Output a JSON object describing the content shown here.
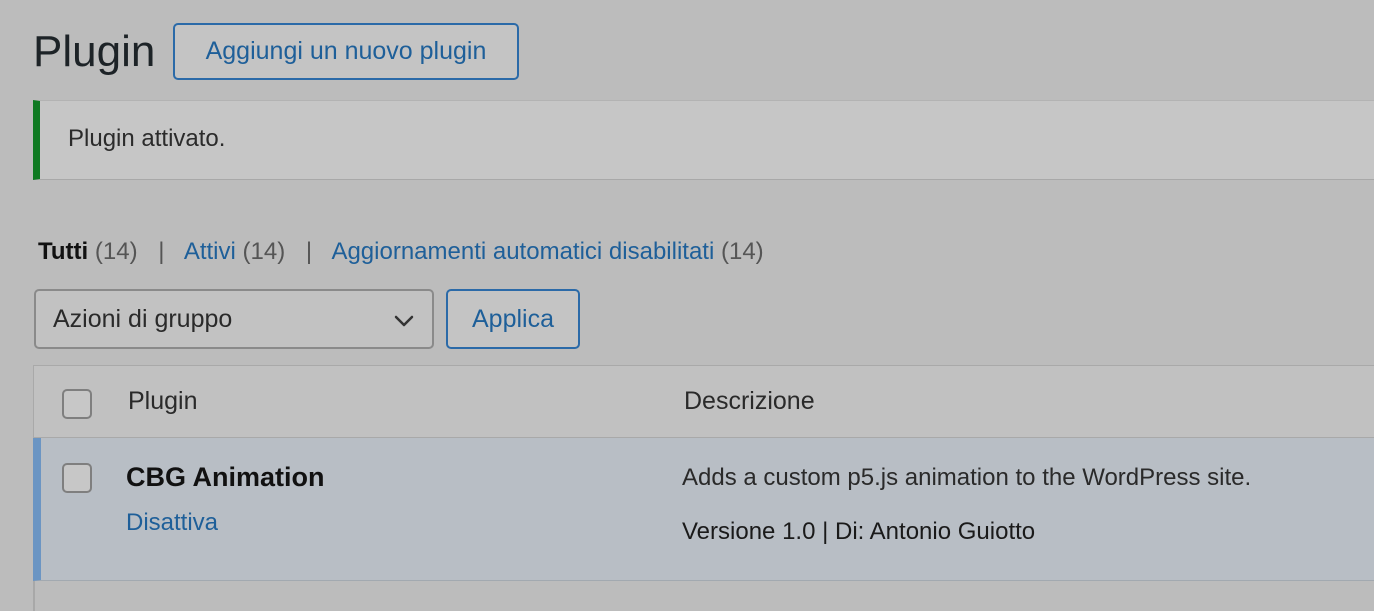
{
  "header": {
    "title": "Plugin",
    "add_new_label": "Aggiungi un nuovo plugin"
  },
  "notice": {
    "message": "Plugin attivato.",
    "accent_color": "#0f7a22"
  },
  "filters": {
    "all_label": "Tutti",
    "all_count": "(14)",
    "active_label": "Attivi",
    "active_count": "(14)",
    "auto_updates_label": "Aggiornamenti automatici disabilitati",
    "auto_updates_count": "(14)",
    "separator": "|"
  },
  "bulk_actions": {
    "selected": "Azioni di gruppo",
    "apply_label": "Applica"
  },
  "table": {
    "columns": [
      "Plugin",
      "Descrizione"
    ],
    "rows": [
      {
        "name": "CBG Animation",
        "action": "Disattiva",
        "description": "Adds a custom p5.js animation to the WordPress site.",
        "meta": "Versione 1.0 | Di: Antonio Guiotto",
        "active_color": "#6b95c3"
      }
    ]
  }
}
